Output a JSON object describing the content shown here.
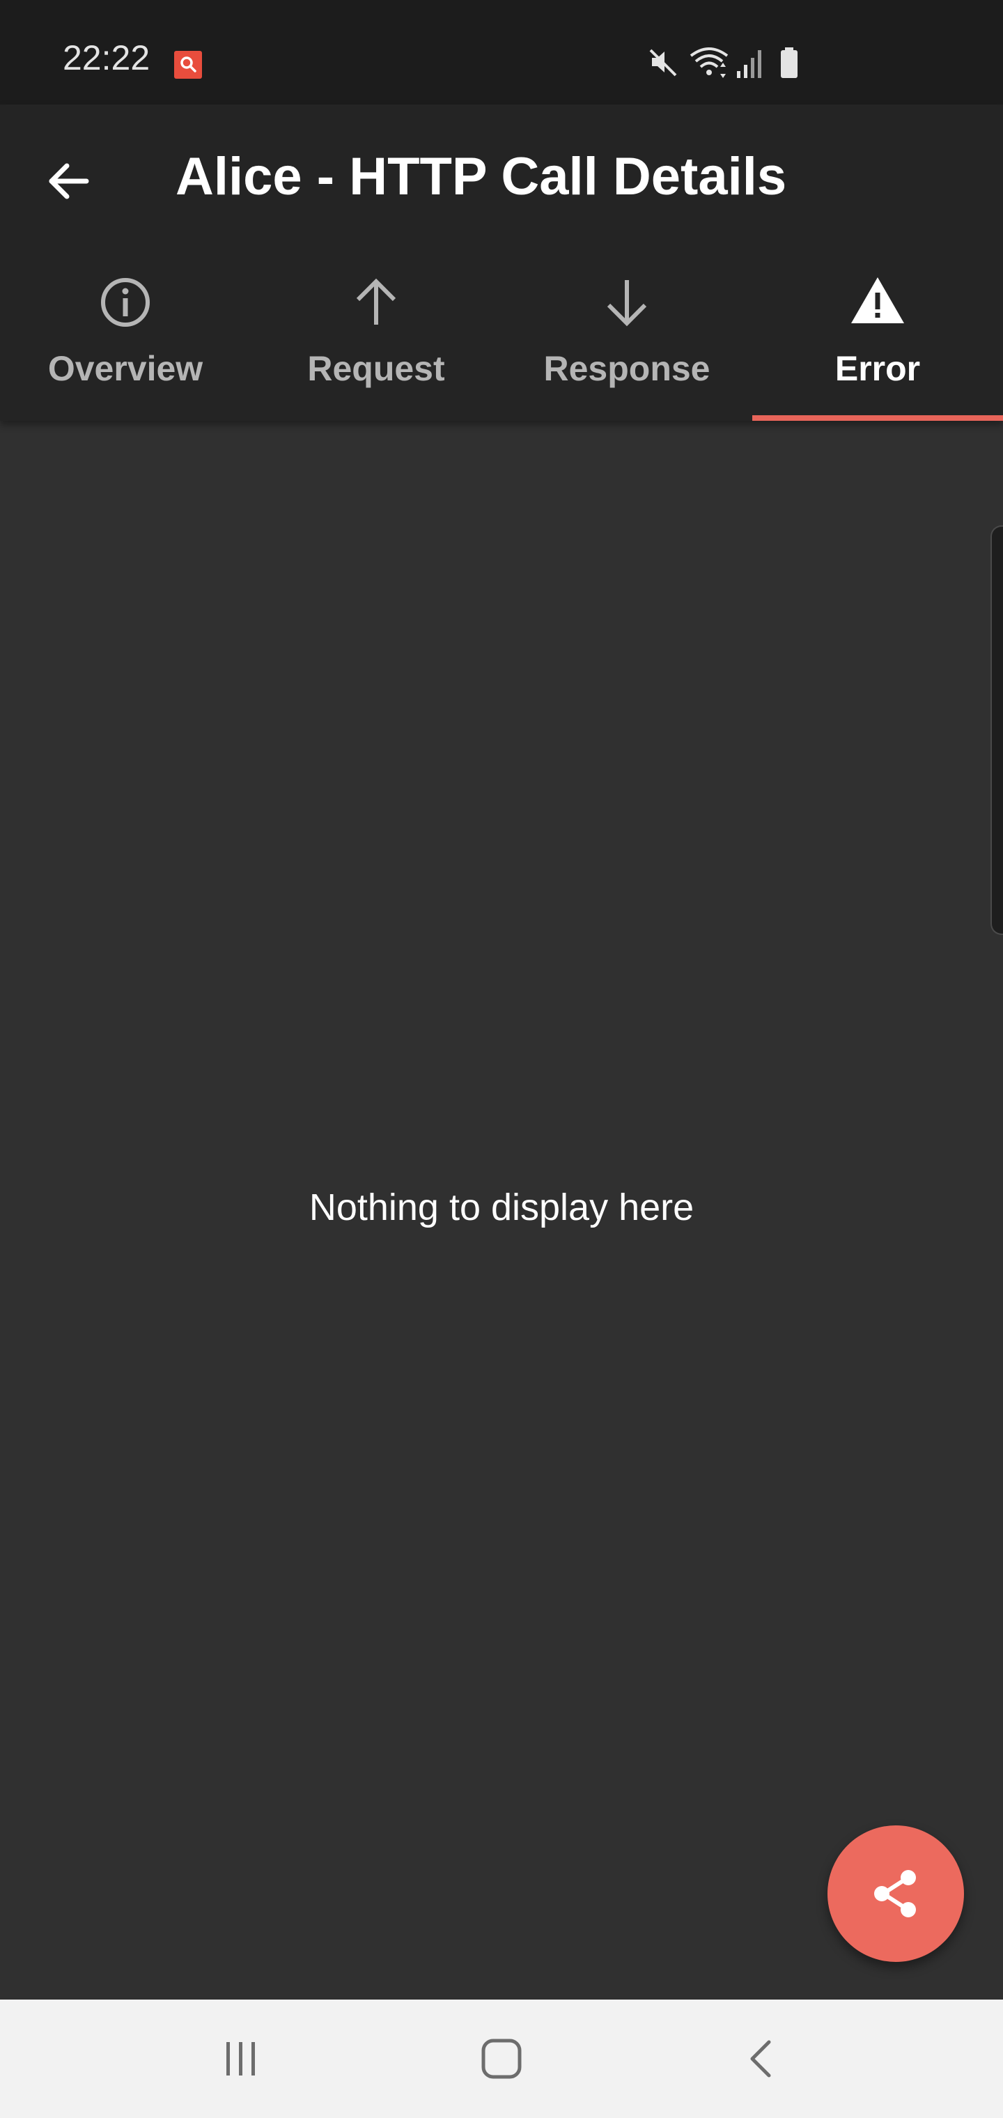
{
  "status_bar": {
    "time": "22:22",
    "app_icon": "search-notification-icon",
    "icons": [
      "mute-icon",
      "wifi-icon",
      "signal-icon",
      "battery-icon"
    ]
  },
  "app_bar": {
    "back_icon": "arrow-left-icon",
    "title": "Alice - HTTP Call Details"
  },
  "tabs": [
    {
      "label": "Overview",
      "icon": "info-icon",
      "active": false
    },
    {
      "label": "Request",
      "icon": "arrow-up-icon",
      "active": false
    },
    {
      "label": "Response",
      "icon": "arrow-down-icon",
      "active": false
    },
    {
      "label": "Error",
      "icon": "warning-icon",
      "active": true
    }
  ],
  "content": {
    "empty_message": "Nothing to display here"
  },
  "fab": {
    "icon": "share-icon"
  },
  "nav_bar": {
    "icons": [
      "recents-icon",
      "home-icon",
      "back-icon"
    ]
  },
  "colors": {
    "accent": "#ec6a5e",
    "tab_indicator": "#e8655a",
    "background": "#303030",
    "app_bar": "#242424",
    "status_bar": "#1c1c1c",
    "nav_bar": "#f2f2f2"
  }
}
